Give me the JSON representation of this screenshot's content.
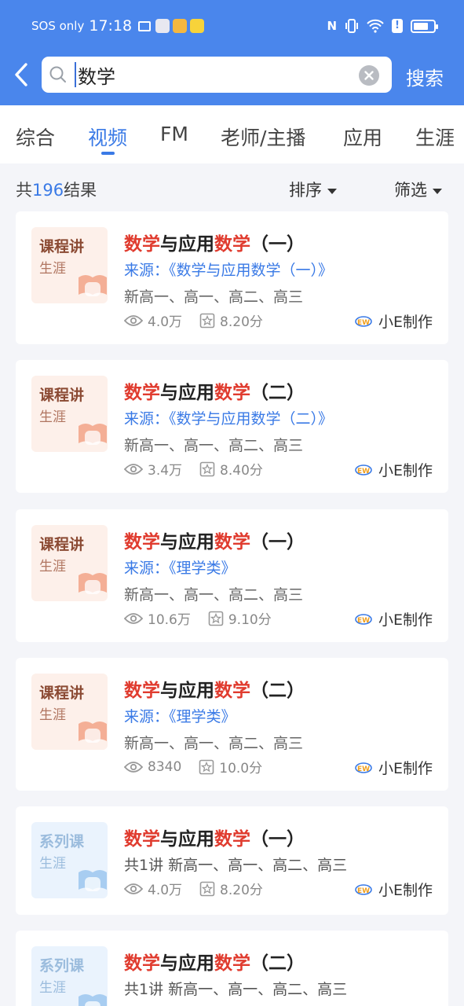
{
  "status": {
    "carrier": "SOS only",
    "time": "17:18",
    "colors": {
      "app1": "#e8e8f0",
      "app2": "#e76f51",
      "app3": "#f4b740",
      "app4": "#f7d33a"
    }
  },
  "header": {
    "back_icon": "chevron-left-icon",
    "search_value": "数学",
    "search_button": "搜索"
  },
  "tabs": [
    {
      "label": "综合"
    },
    {
      "label": "视频"
    },
    {
      "label": "FM"
    },
    {
      "label": "老师/主播"
    },
    {
      "label": "应用"
    },
    {
      "label": "生涯"
    }
  ],
  "active_tab": "视频",
  "summary": {
    "prefix": "共",
    "count": "196",
    "suffix": "结果",
    "sort": "排序",
    "filter": "筛选"
  },
  "results": [
    {
      "thumb": {
        "tag": "课程讲",
        "sub": "生涯",
        "style": "warm"
      },
      "title": {
        "a": "数学",
        "b": "与应用",
        "c": "数学",
        "d": "（一）"
      },
      "line2": "来源：《数学与应用数学（一）》",
      "line3": "新高一、高一、高二、高三",
      "views": "4.0万",
      "score": "8.20分",
      "maker": "小E制作"
    },
    {
      "thumb": {
        "tag": "课程讲",
        "sub": "生涯",
        "style": "warm"
      },
      "title": {
        "a": "数学",
        "b": "与应用",
        "c": "数学",
        "d": "（二）"
      },
      "line2": "来源：《数学与应用数学（二）》",
      "line3": "新高一、高一、高二、高三",
      "views": "3.4万",
      "score": "8.40分",
      "maker": "小E制作"
    },
    {
      "thumb": {
        "tag": "课程讲",
        "sub": "生涯",
        "style": "warm"
      },
      "title": {
        "a": "数学",
        "b": "与应用",
        "c": "数学",
        "d": "（一）"
      },
      "line2": "来源：《理学类》",
      "line3": "新高一、高一、高二、高三",
      "views": "10.6万",
      "score": "9.10分",
      "maker": "小E制作"
    },
    {
      "thumb": {
        "tag": "课程讲",
        "sub": "生涯",
        "style": "warm"
      },
      "title": {
        "a": "数学",
        "b": "与应用",
        "c": "数学",
        "d": "（二）"
      },
      "line2": "来源：《理学类》",
      "line3": "新高一、高一、高二、高三",
      "views": "8340",
      "score": "10.0分",
      "maker": "小E制作"
    },
    {
      "thumb": {
        "tag": "系列课",
        "sub": "生涯",
        "style": "cool"
      },
      "title": {
        "a": "数学",
        "b": "与应用",
        "c": "数学",
        "d": "（一）"
      },
      "line2": "共1讲   新高一、高一、高二、高三",
      "views": "4.0万",
      "score": "8.20分",
      "maker": "小E制作"
    },
    {
      "thumb": {
        "tag": "系列课",
        "sub": "生涯",
        "style": "cool"
      },
      "title": {
        "a": "数学",
        "b": "与应用",
        "c": "数学",
        "d": "（二）"
      },
      "line2": "共1讲   新高一、高一、高二、高三",
      "views": "",
      "score": "",
      "maker": ""
    }
  ],
  "colors": {
    "accent": "#4a86ec",
    "highlight": "#e03b2e",
    "link": "#3a7ae6"
  }
}
